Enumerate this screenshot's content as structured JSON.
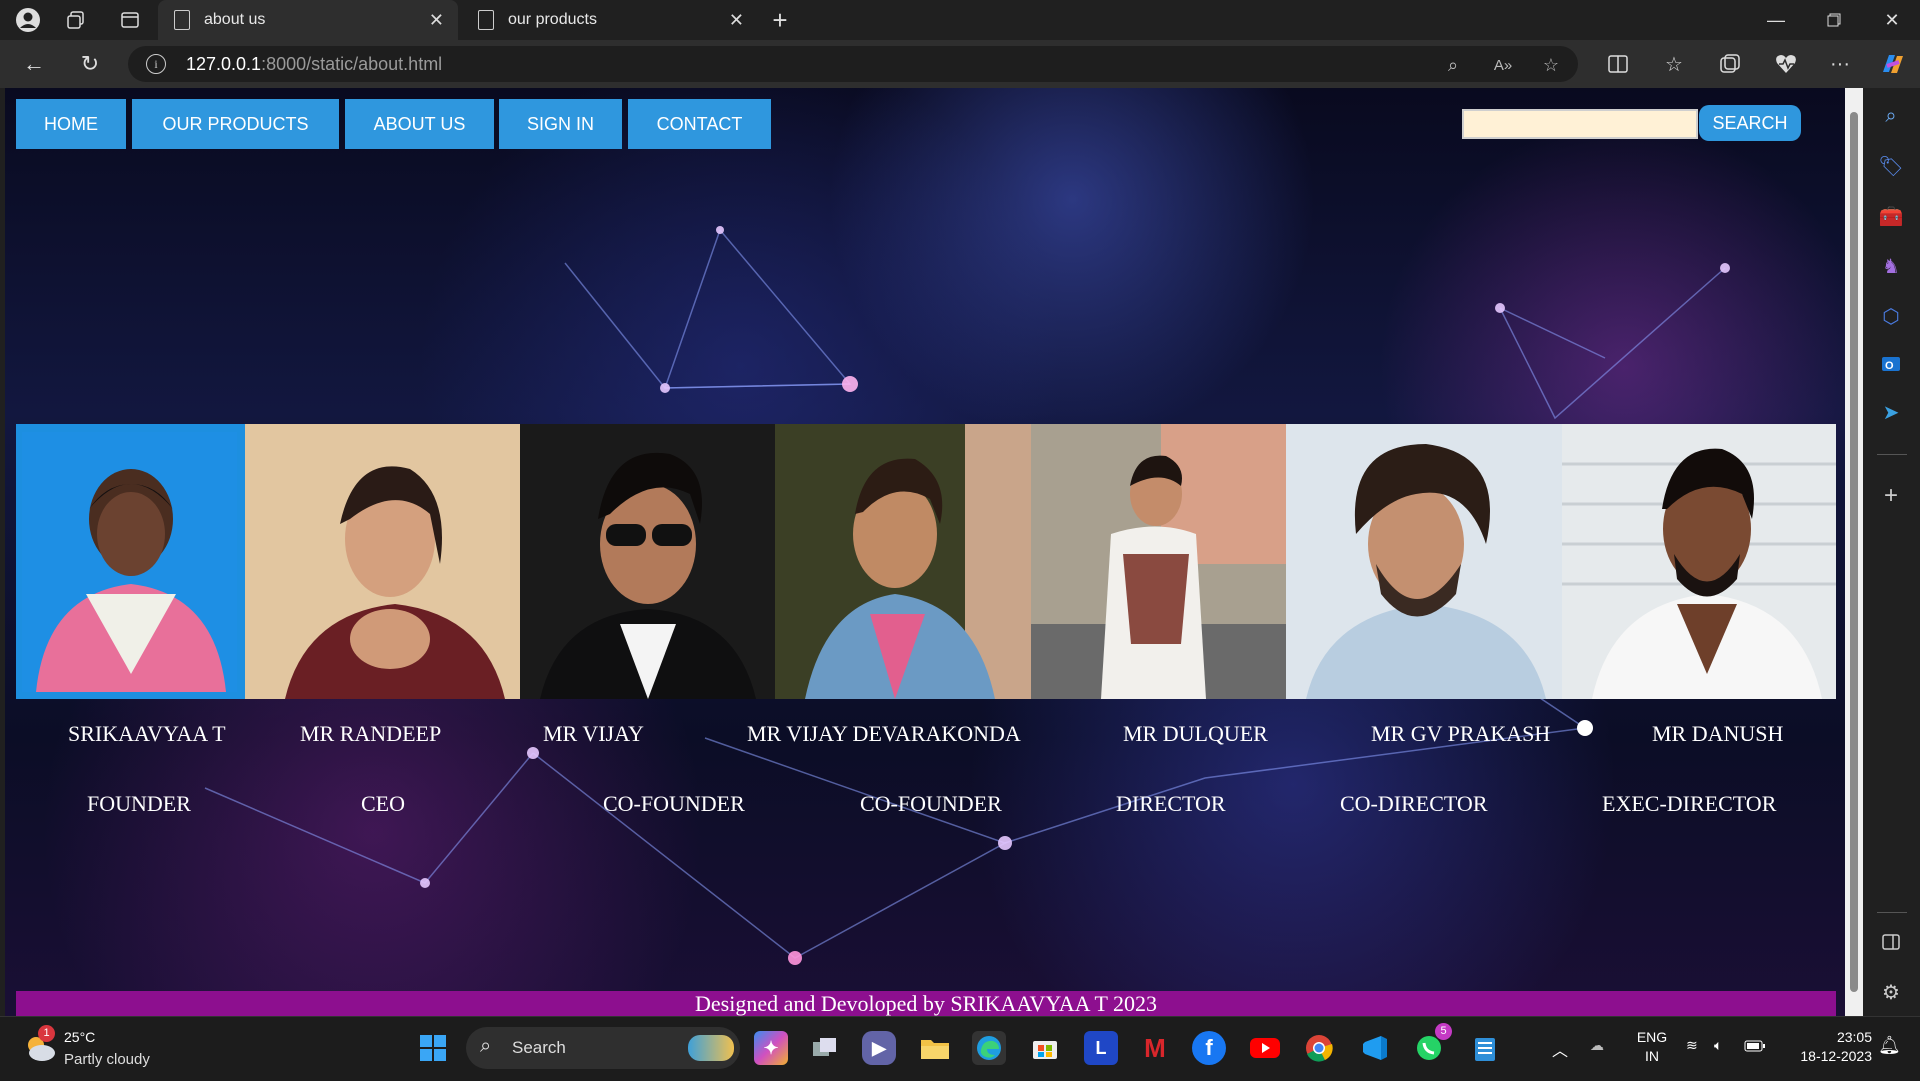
{
  "browser": {
    "tabs": [
      {
        "title": "about us",
        "active": true
      },
      {
        "title": "our products",
        "active": false
      }
    ],
    "url_host": "127.0.0.1",
    "url_path": ":8000/static/about.html"
  },
  "nav": {
    "items": [
      "HOME",
      "OUR PRODUCTS",
      "ABOUT US",
      "SIGN IN",
      "CONTACT"
    ],
    "search_button": "SEARCH",
    "search_value": "",
    "accent": "#2f97de"
  },
  "team": [
    {
      "name": "SRIKAAVYAA T",
      "role": "FOUNDER"
    },
    {
      "name": "MR RANDEEP",
      "role": "CEO"
    },
    {
      "name": "MR VIJAY",
      "role": "CO-FOUNDER"
    },
    {
      "name": "MR VIJAY DEVARAKONDA",
      "role": "CO-FOUNDER"
    },
    {
      "name": "MR DULQUER",
      "role": "DIRECTOR"
    },
    {
      "name": "MR GV PRAKASH",
      "role": "CO-DIRECTOR"
    },
    {
      "name": "MR DANUSH",
      "role": "EXEC-DIRECTOR"
    }
  ],
  "footer": {
    "text": "Designed and Devoloped by SRIKAAVYAA T 2023",
    "color": "#8d0f8f"
  },
  "taskbar": {
    "weather_temp": "25°C",
    "weather_desc": "Partly cloudy",
    "weather_badge": "1",
    "search_label": "Search",
    "whatsapp_badge": "5",
    "lang_top": "ENG",
    "lang_bottom": "IN",
    "time": "23:05",
    "date": "18-12-2023"
  }
}
